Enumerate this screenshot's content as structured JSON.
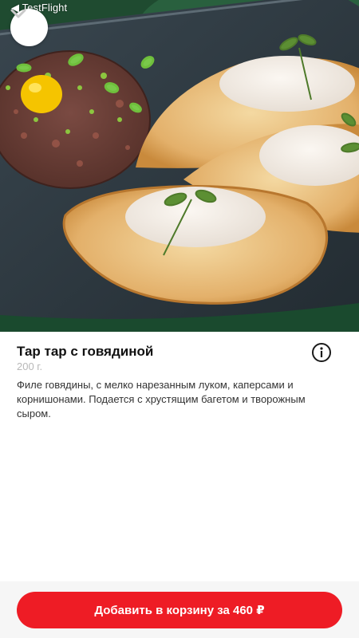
{
  "status": {
    "back_label": "◀ TestFlight"
  },
  "hero": {
    "photo": "beef-tartare-with-crostini-photo"
  },
  "icons": {
    "close": "chevron-down-icon",
    "info": "info-icon"
  },
  "product": {
    "title": "Тар тар с говядиной",
    "weight": "200 г.",
    "description": "Филе говядины, с мелко нарезанным луком, каперсами и корнишонами. Подается с хрустящим багетом и творожным сыром."
  },
  "cart": {
    "button_label": "Добавить в корзину за 460 ₽"
  },
  "colors": {
    "accent": "#ee1c25",
    "background": "#ffffff",
    "muted_text": "#b8b8b8"
  }
}
